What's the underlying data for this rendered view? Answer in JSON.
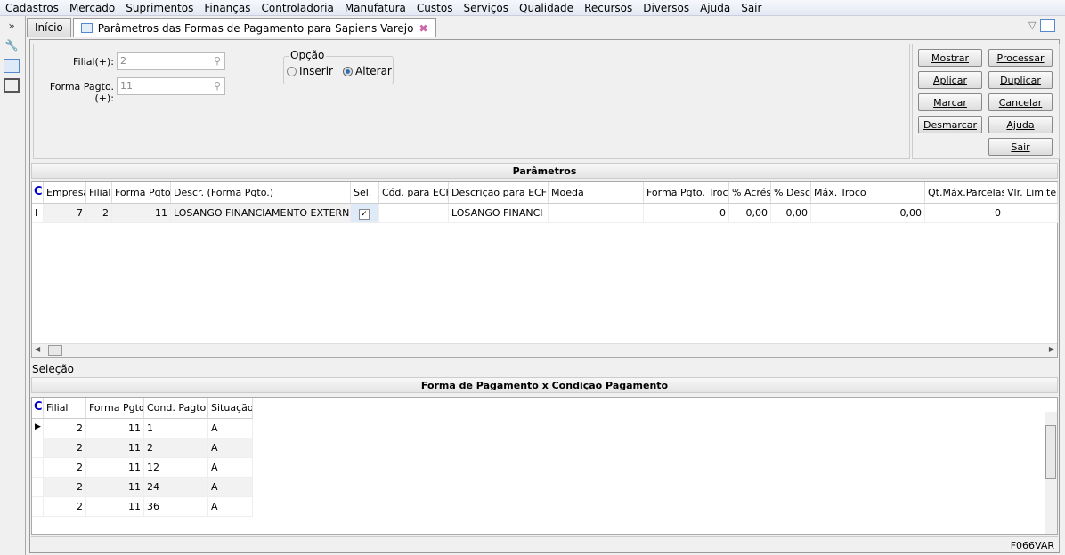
{
  "menu": [
    "Cadastros",
    "Mercado",
    "Suprimentos",
    "Finanças",
    "Controladoria",
    "Manufatura",
    "Custos",
    "Serviços",
    "Qualidade",
    "Recursos",
    "Diversos",
    "Ajuda",
    "Sair"
  ],
  "tabs": {
    "home": "Início",
    "active": "Parâmetros das Formas de Pagamento para Sapiens Varejo"
  },
  "form": {
    "filial_label": "Filial(+):",
    "filial_value": "2",
    "forma_label": "Forma Pagto.(+):",
    "forma_value": "11",
    "opcao_title": "Opção",
    "opt_inserir": "Inserir",
    "opt_alterar": "Alterar",
    "selected_option": "Alterar"
  },
  "buttons": {
    "mostrar": "Mostrar",
    "aplicar": "Aplicar",
    "marcar": "Marcar",
    "desmarcar": "Desmarcar",
    "processar": "Processar",
    "duplicar": "Duplicar",
    "cancelar": "Cancelar",
    "ajuda": "Ajuda",
    "sair": "Sair"
  },
  "params": {
    "title": "Parâmetros",
    "columns": [
      "C",
      "Empresa",
      "Filial",
      "Forma Pgto.",
      "Descr. (Forma Pgto.)",
      "Sel.",
      "Cód. para ECF",
      "Descrição para ECF",
      "Moeda",
      "Forma Pgto. Troco",
      "% Acrés.",
      "% Desc.",
      "Máx. Troco",
      "Qt.Máx.Parcelas",
      "Vlr. Limite"
    ],
    "rows": [
      {
        "marker": "I",
        "empresa": "7",
        "filial": "2",
        "forma": "11",
        "descr": "LOSANGO FINANCIAMENTO EXTERNO",
        "sel": true,
        "cod_ecf": "",
        "desc_ecf": "LOSANGO FINANCI",
        "moeda": "",
        "troco": "0",
        "acres": "0,00",
        "desc": "0,00",
        "max_troco": "0,00",
        "qt_parcelas": "0",
        "vlr_limite": ""
      }
    ]
  },
  "selecao_label": "Seleção",
  "cond": {
    "title": "Forma de Pagamento x Condição Pagamento",
    "columns": [
      "C",
      "Filial",
      "Forma Pgto.",
      "Cond. Pagto.",
      "Situação"
    ],
    "rows": [
      {
        "filial": "2",
        "forma": "11",
        "cond": "1",
        "sit": "A"
      },
      {
        "filial": "2",
        "forma": "11",
        "cond": "2",
        "sit": "A"
      },
      {
        "filial": "2",
        "forma": "11",
        "cond": "12",
        "sit": "A"
      },
      {
        "filial": "2",
        "forma": "11",
        "cond": "24",
        "sit": "A"
      },
      {
        "filial": "2",
        "forma": "11",
        "cond": "36",
        "sit": "A"
      }
    ]
  },
  "status": "F066VAR"
}
